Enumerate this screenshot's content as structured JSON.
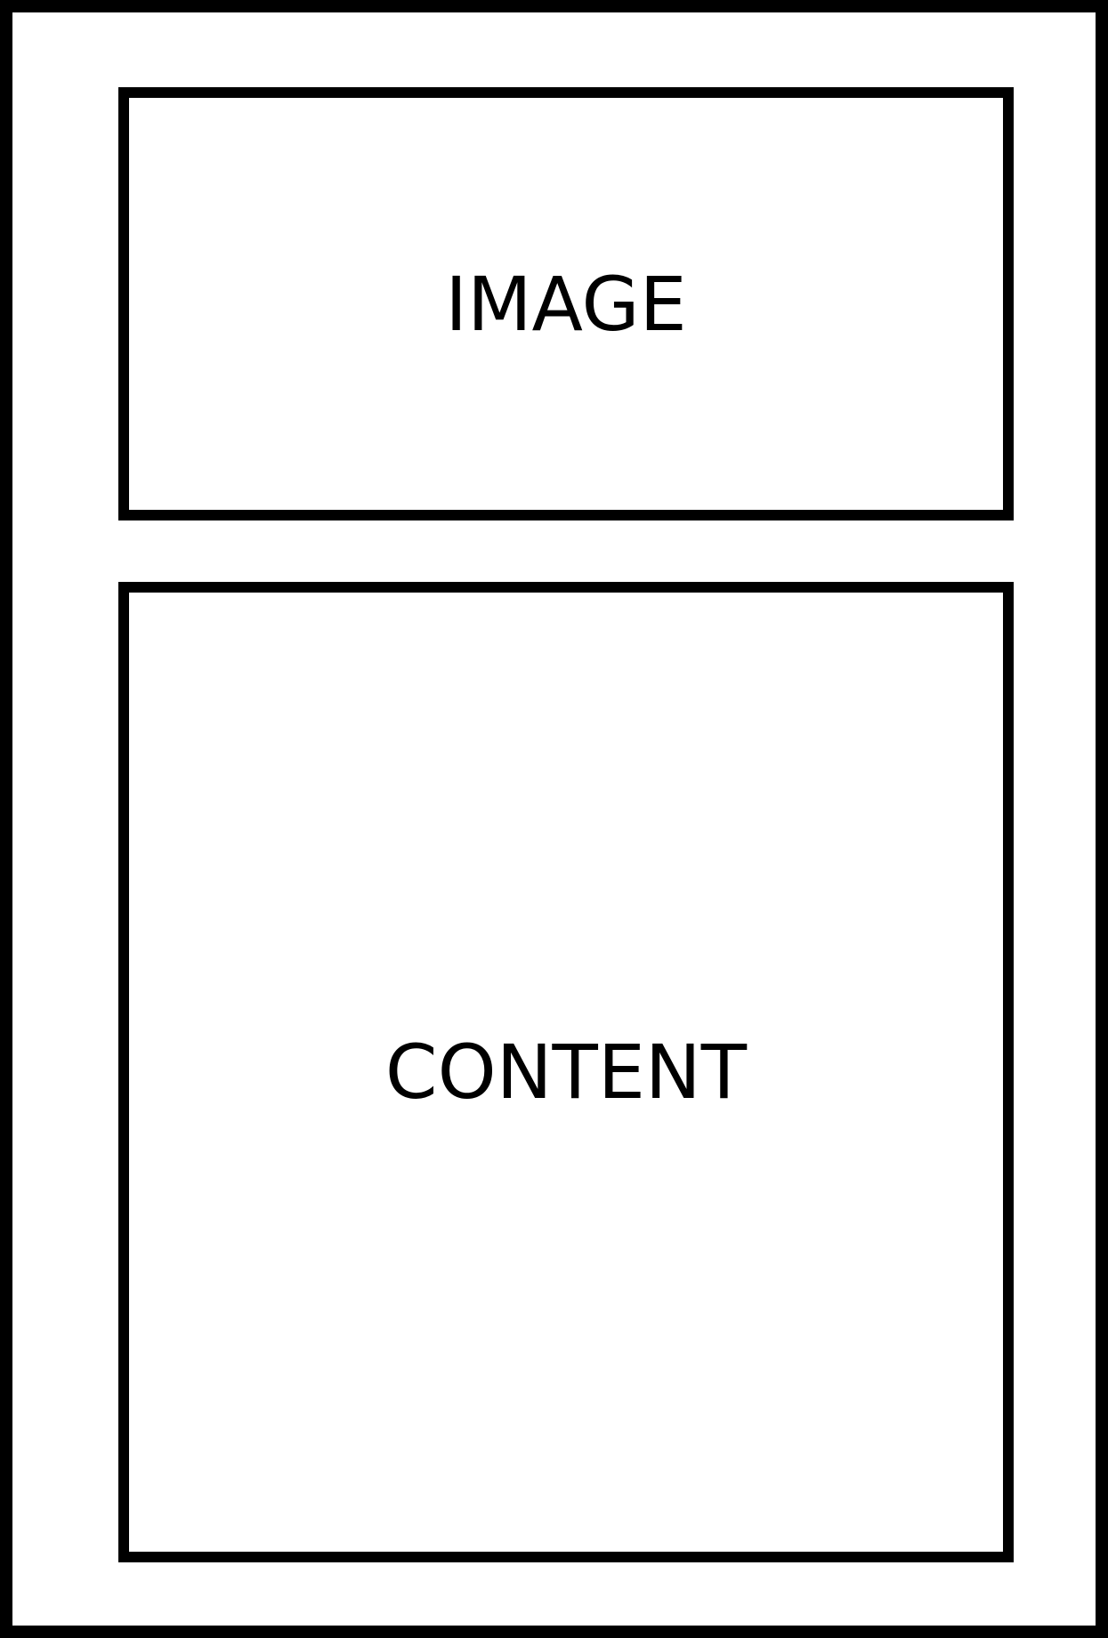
{
  "layout_diagram": {
    "image_label": "IMAGE",
    "content_label": "CONTENT"
  },
  "colors": {
    "stroke": "#000000",
    "background": "#ffffff"
  }
}
